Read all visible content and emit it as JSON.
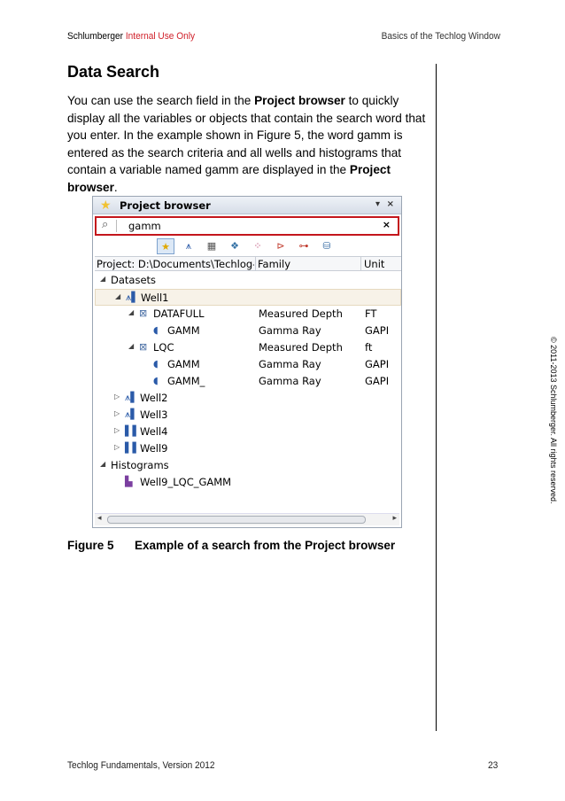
{
  "header": {
    "company": "Schlumberger",
    "classification": "Internal Use Only",
    "chapter": "Basics of the Techlog Window"
  },
  "copyright": "© 2011-2013 Schlumberger. All rights reserved.",
  "section": {
    "title": "Data Search",
    "para_parts": [
      "You can use the search field in the ",
      "Project browser",
      " to quickly display all the variables or objects that contain the search word that you enter. In the example shown in Figure 5, the word gamm is entered as the search criteria and all wells and histograms that contain a variable named gamm are displayed in the ",
      "Project browser",
      "."
    ]
  },
  "project_browser": {
    "title": "Project browser",
    "search_value": "gamm",
    "columns": {
      "project": "Project: D:\\Documents\\Techlog-Pro",
      "family": "Family",
      "unit": "Unit"
    },
    "rows": [
      {
        "label": "Datasets",
        "family": "",
        "unit": ""
      },
      {
        "label": "Well1",
        "family": "",
        "unit": ""
      },
      {
        "label": "DATAFULL",
        "family": "Measured Depth",
        "unit": "FT"
      },
      {
        "label": "GAMM",
        "family": "Gamma Ray",
        "unit": "GAPI"
      },
      {
        "label": "LQC",
        "family": "Measured Depth",
        "unit": "ft"
      },
      {
        "label": "GAMM",
        "family": "Gamma Ray",
        "unit": "GAPI"
      },
      {
        "label": "GAMM_",
        "family": "Gamma Ray",
        "unit": "GAPI"
      },
      {
        "label": "Well2",
        "family": "",
        "unit": ""
      },
      {
        "label": "Well3",
        "family": "",
        "unit": ""
      },
      {
        "label": "Well4",
        "family": "",
        "unit": ""
      },
      {
        "label": "Well9",
        "family": "",
        "unit": ""
      },
      {
        "label": "Histograms",
        "family": "",
        "unit": ""
      },
      {
        "label": "Well9_LQC_GAMM",
        "family": "",
        "unit": ""
      }
    ]
  },
  "figure": {
    "number": "Figure 5",
    "caption": "Example of a search from the Project browser"
  },
  "footer": {
    "left": "Techlog Fundamentals, Version 2012",
    "page": "23"
  }
}
